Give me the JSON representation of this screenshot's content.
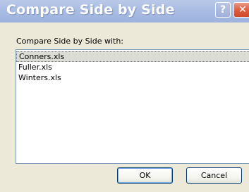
{
  "window": {
    "title": "Compare Side by Side",
    "help_glyph": "?",
    "close_glyph": "✕"
  },
  "dialog": {
    "prompt": "Compare Side by Side with:",
    "files": [
      {
        "name": "Conners.xls",
        "selected": true
      },
      {
        "name": "Fuller.xls",
        "selected": false
      },
      {
        "name": "Winters.xls",
        "selected": false
      }
    ],
    "ok_label": "OK",
    "cancel_label": "Cancel"
  },
  "icons": {
    "help": "question-mark-icon",
    "close": "close-x-icon"
  },
  "colors": {
    "titlebar": "#a9bde3",
    "close_button": "#dd5b3c",
    "dialog_background": "#ece9d8",
    "selected_row": "#dcdcd6",
    "default_button_focus": "#6ea4e0"
  }
}
